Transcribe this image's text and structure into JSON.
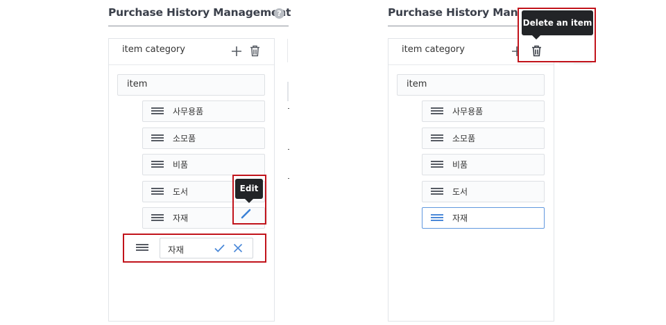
{
  "page": {
    "title": "Purchase History Management",
    "title_right_visible": "Purchase History Manage",
    "help_label": "?"
  },
  "left_panel": {
    "header": "item category",
    "root_item": "item",
    "items": [
      {
        "label": "사무용품"
      },
      {
        "label": "소모품"
      },
      {
        "label": "비품"
      },
      {
        "label": "도서"
      },
      {
        "label": "자재"
      }
    ],
    "edit_tooltip": "Edit",
    "edit_value": "자재"
  },
  "right_panel": {
    "header": "item category",
    "root_item": "item",
    "items": [
      {
        "label": "사무용품"
      },
      {
        "label": "소모품"
      },
      {
        "label": "비품"
      },
      {
        "label": "도서"
      },
      {
        "label": "자재",
        "selected": true
      }
    ],
    "delete_tooltip": "Delete an item"
  },
  "colors": {
    "highlight_red": "#c1121a",
    "accent_blue": "#4a88d8",
    "tooltip_bg": "#222427"
  },
  "icons": [
    "help-icon",
    "plus-icon",
    "trash-icon",
    "drag-handle-icon",
    "pencil-icon",
    "check-icon",
    "close-icon"
  ]
}
